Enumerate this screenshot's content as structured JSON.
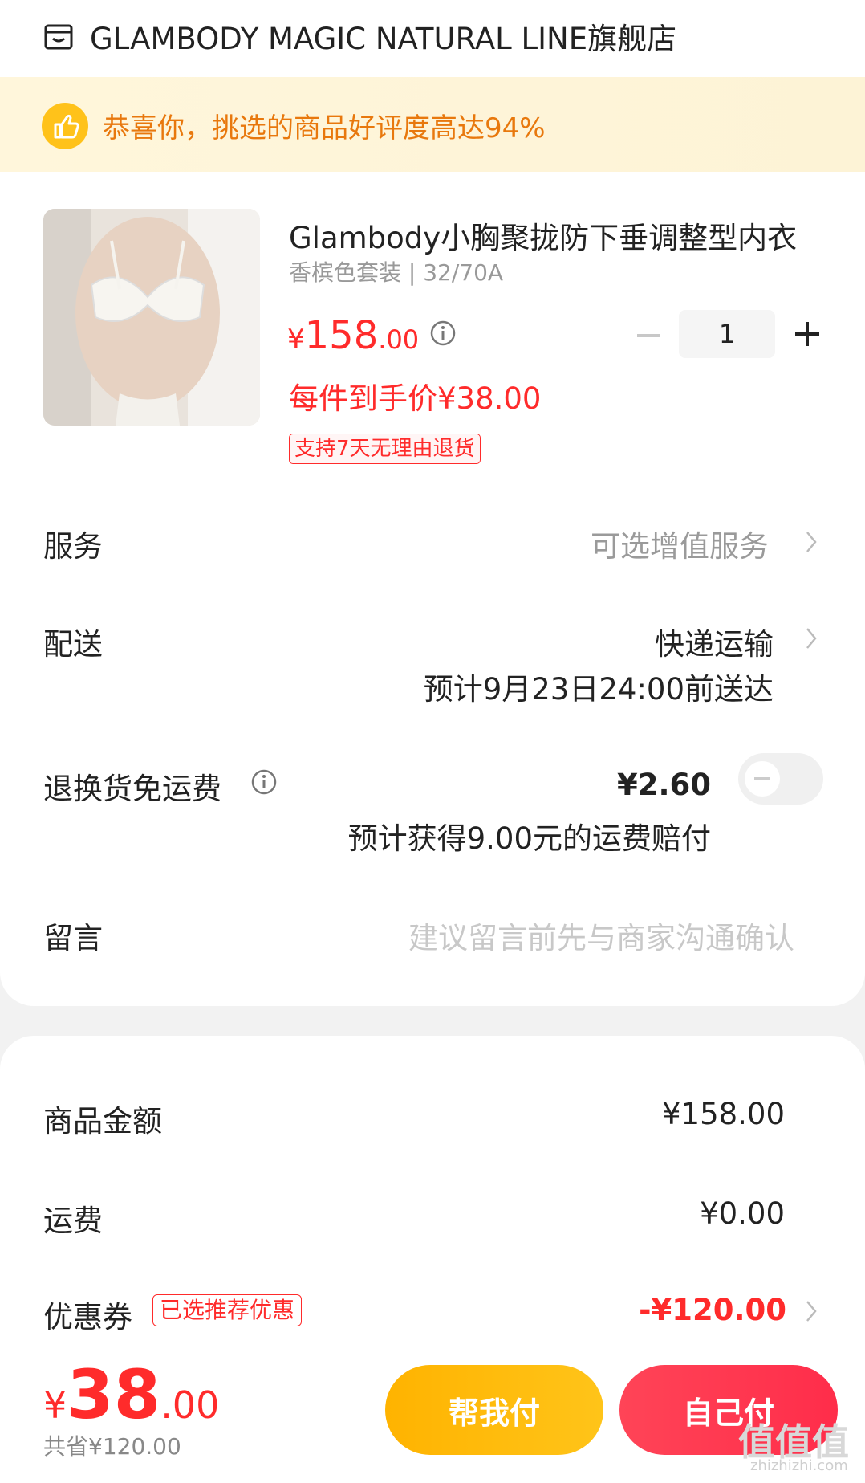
{
  "store": {
    "name": "GLAMBODY MAGIC NATURAL LINE旗舰店",
    "icon": "store-icon"
  },
  "banner": {
    "text": "恭喜你，挑选的商品好评度高达94%",
    "icon": "thumbs-up-icon"
  },
  "product": {
    "title": "Glambody小胸聚拢防下垂调整型内衣",
    "sku": "香槟色套装 | 32/70A",
    "price_symbol": "¥",
    "price_int": "158",
    "price_dec": ".00",
    "per_item_price": "每件到手价¥38.00",
    "return_tag": "支持7天无理由退货",
    "quantity": "1"
  },
  "rows": {
    "service": {
      "label": "服务",
      "value": "可选增值服务"
    },
    "delivery": {
      "label": "配送",
      "value": "快递运输",
      "eta": "预计9月23日24:00前送达"
    },
    "return_shipping": {
      "label": "退换货免运费",
      "price": "¥2.60",
      "note": "预计获得9.00元的运费赔付",
      "toggle_on": false
    },
    "message": {
      "label": "留言",
      "placeholder": "建议留言前先与商家沟通确认"
    }
  },
  "summary": {
    "goods": {
      "label": "商品金额",
      "value": "¥158.00"
    },
    "shipping": {
      "label": "运费",
      "value": "¥0.00"
    },
    "coupon": {
      "label": "优惠券",
      "badge": "已选推荐优惠",
      "value": "-¥120.00"
    }
  },
  "footer": {
    "total_symbol": "¥",
    "total_int": "38",
    "total_dec": ".00",
    "saved": "共省¥120.00",
    "help_pay": "帮我付",
    "self_pay": "自己付"
  },
  "watermark": {
    "main": "值值值",
    "sub": "zhizhizhi.com"
  },
  "colors": {
    "accent_red": "#ff2b2b",
    "banner_orange": "#e8780d",
    "help_btn": "#ffb300",
    "self_btn": "#ff2d4a"
  }
}
